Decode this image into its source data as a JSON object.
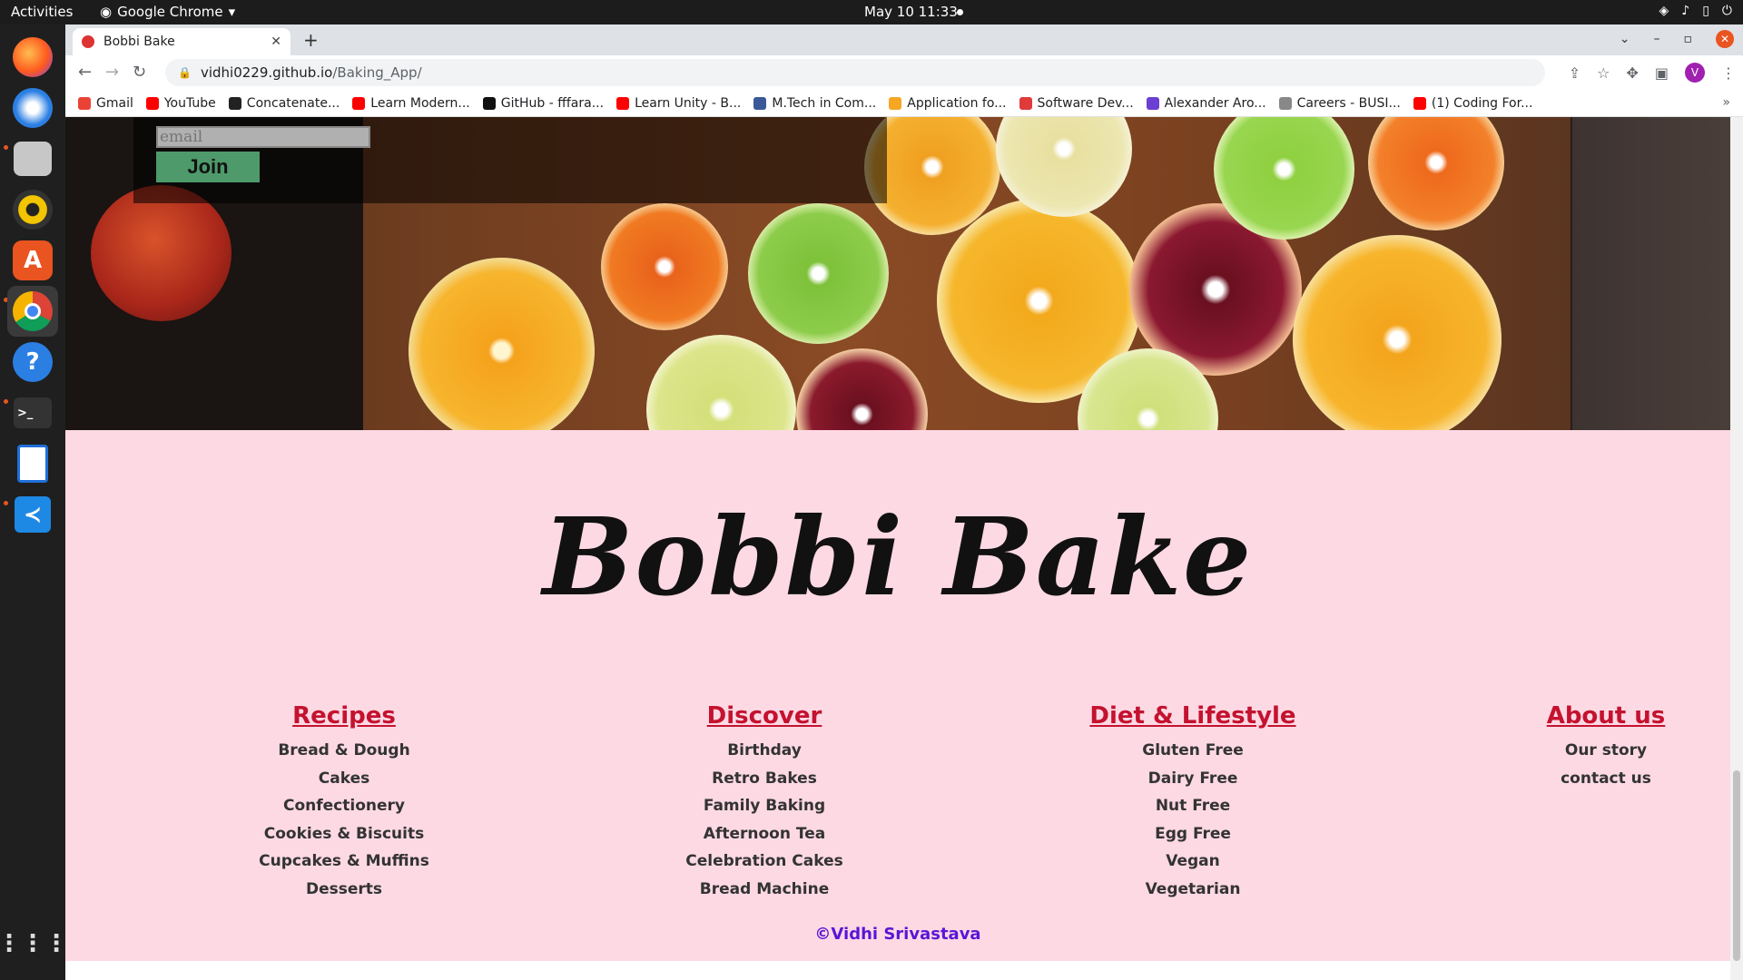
{
  "os": {
    "activities": "Activities",
    "app_name": "Google Chrome",
    "clock": "May 10  11:33"
  },
  "browser": {
    "tab_title": "Bobbi Bake",
    "url_host": "vidhi0229.github.io",
    "url_path": "/Baking_App/",
    "avatar_letter": "V",
    "bookmarks": [
      {
        "label": "Gmail",
        "color": "#ea4335"
      },
      {
        "label": "YouTube",
        "color": "#ff0000"
      },
      {
        "label": "Concatenate...",
        "color": "#222222"
      },
      {
        "label": "Learn Modern...",
        "color": "#ff0000"
      },
      {
        "label": "GitHub - fffara...",
        "color": "#111111"
      },
      {
        "label": "Learn Unity - B...",
        "color": "#ff0000"
      },
      {
        "label": "M.Tech in Com...",
        "color": "#3b5998"
      },
      {
        "label": "Application fo...",
        "color": "#f5a623"
      },
      {
        "label": "Software Dev...",
        "color": "#e03a3a"
      },
      {
        "label": "Alexander Aro...",
        "color": "#6a3fd1"
      },
      {
        "label": "Careers - BUSI...",
        "color": "#888888"
      },
      {
        "label": "(1) Coding For...",
        "color": "#ff0000"
      }
    ]
  },
  "page": {
    "email_placeholder": "email",
    "join_label": "Join",
    "brand": "Bobbi Bake",
    "columns": [
      {
        "heading": "Recipes",
        "links": [
          "Bread & Dough",
          "Cakes",
          "Confectionery",
          "Cookies & Biscuits",
          "Cupcakes & Muffins",
          "Desserts"
        ]
      },
      {
        "heading": "Discover",
        "links": [
          "Birthday",
          "Retro Bakes",
          "Family Baking",
          "Afternoon Tea",
          "Celebration Cakes",
          "Bread Machine"
        ]
      },
      {
        "heading": "Diet & Lifestyle",
        "links": [
          "Gluten Free",
          "Dairy Free",
          "Nut Free",
          "Egg Free",
          "Vegan",
          "Vegetarian"
        ]
      },
      {
        "heading": "About us",
        "links": [
          "Our story",
          "contact us"
        ]
      }
    ],
    "credit": "©Vidhi Srivastava",
    "colors": {
      "footer_bg": "#fdd9e4",
      "heading": "#c4122f",
      "credit": "#5a16d6",
      "join_bg": "#4e9a6a"
    }
  }
}
